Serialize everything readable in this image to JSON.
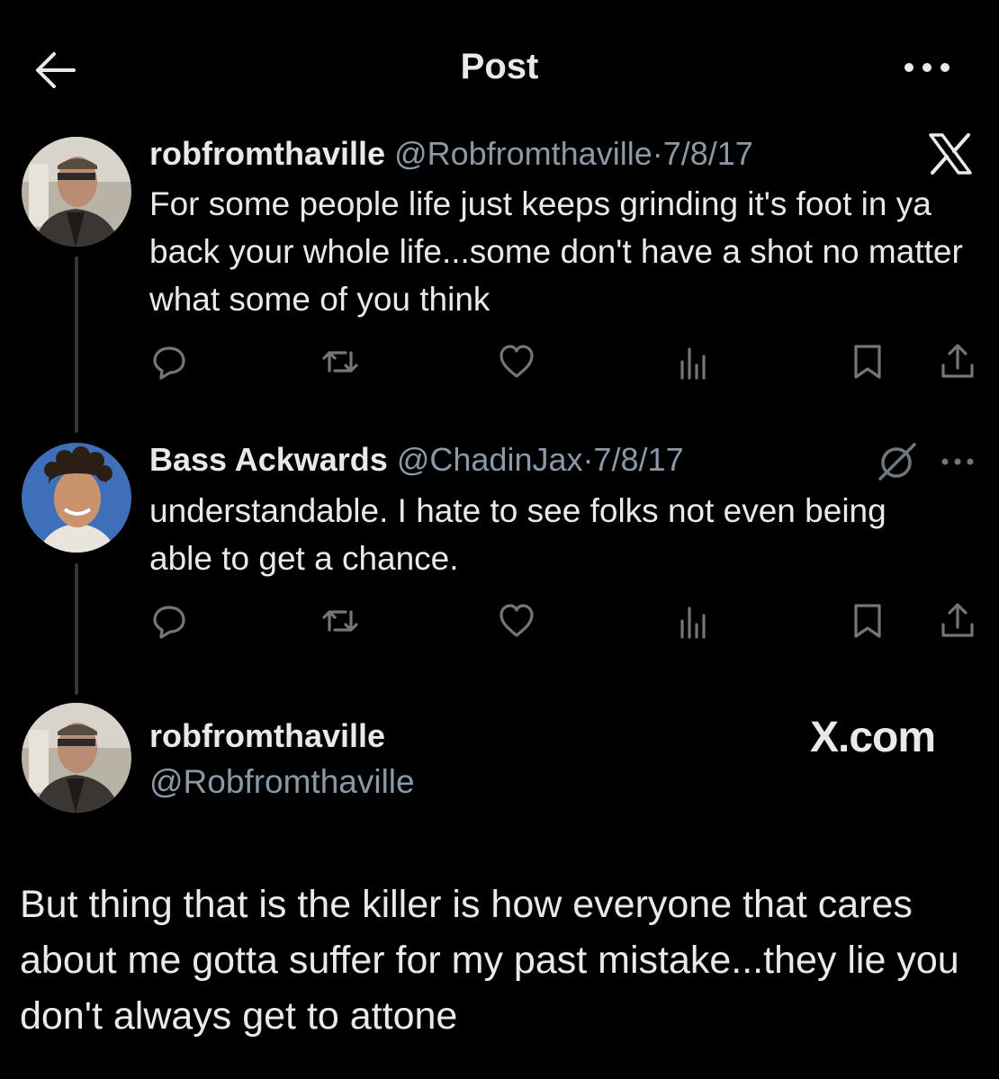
{
  "header": {
    "title": "Post",
    "back_icon": "arrow-left-icon",
    "more_icon": "more-horizontal-icon"
  },
  "tweets": [
    {
      "name": "robfromthaville",
      "handle": "@Robfromthaville",
      "separator": "·",
      "date": "7/8/17",
      "text": "For some people life just keeps grinding it's foot in ya back your whole life...some don't have a shot no matter what some of you think",
      "badge_icon": "x-logo-icon"
    },
    {
      "name": "Bass Ackwards",
      "handle": "@ChadinJax",
      "separator": "·",
      "date": "7/8/17",
      "text": "understandable. I hate to see folks not even being able to get a chance.",
      "badge_icon": "grok-icon"
    }
  ],
  "actions": [
    "reply-icon",
    "retweet-icon",
    "like-icon",
    "views-icon",
    "bookmark-icon",
    "share-icon"
  ],
  "quote": {
    "name": "robfromthaville",
    "handle": "@Robfromthaville",
    "site": "X.com",
    "text": "But thing that is the killer is how everyone that cares about me gotta suffer for my past mistake...they lie you don't always get to attone"
  },
  "colors": {
    "background": "#000000",
    "text": "#e7e9ea",
    "secondary": "#8b98a5",
    "icon": "#71767b",
    "thread_line": "#333639"
  }
}
